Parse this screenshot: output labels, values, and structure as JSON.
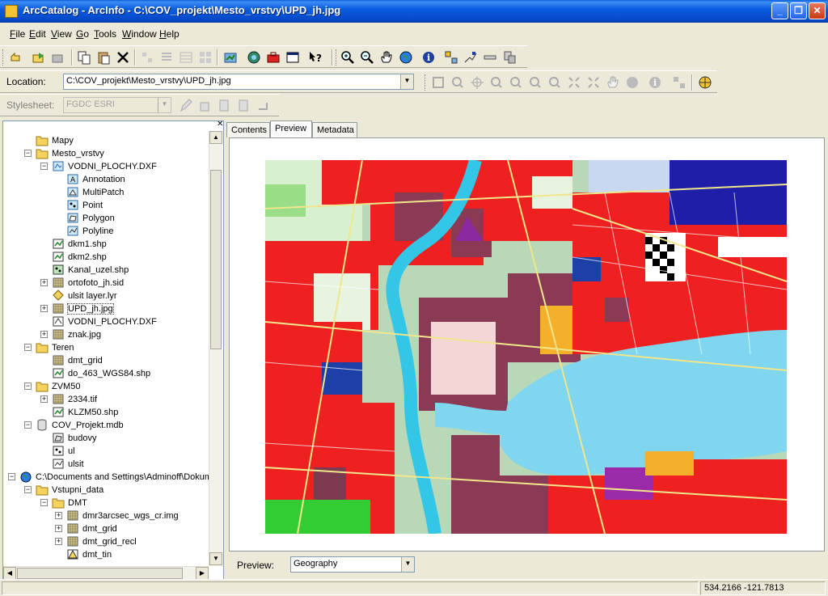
{
  "window": {
    "title": "ArcCatalog - ArcInfo - C:\\COV_projekt\\Mesto_vrstvy\\UPD_jh.jpg",
    "min_glyph": "_",
    "max_glyph": "❐",
    "close_glyph": "✕"
  },
  "menu": [
    {
      "label": "File",
      "key": "F",
      "rest": "ile"
    },
    {
      "label": "Edit",
      "key": "E",
      "rest": "dit"
    },
    {
      "label": "View",
      "key": "V",
      "rest": "iew"
    },
    {
      "label": "Go",
      "key": "G",
      "rest": "o"
    },
    {
      "label": "Tools",
      "key": "T",
      "rest": "ools"
    },
    {
      "label": "Window",
      "key": "W",
      "rest": "indow"
    },
    {
      "label": "Help",
      "key": "H",
      "rest": "elp"
    }
  ],
  "location": {
    "label": "Location:",
    "value": "C:\\COV_projekt\\Mesto_vrstvy\\UPD_jh.jpg"
  },
  "stylesheet": {
    "label": "Stylesheet:",
    "value": "FGDC ESRI"
  },
  "panel": {
    "close_glyph": "✕"
  },
  "tree": [
    {
      "label": "Mapy",
      "icon": "folder-icon"
    },
    {
      "label": "Mesto_vrstvy",
      "icon": "folder-icon"
    },
    {
      "label": "VODNI_PLOCHY.DXF",
      "icon": "cad-icon"
    },
    {
      "label": "Annotation",
      "icon": "annotation-icon"
    },
    {
      "label": "MultiPatch",
      "icon": "multipatch-icon"
    },
    {
      "label": "Point",
      "icon": "point-icon"
    },
    {
      "label": "Polygon",
      "icon": "polygon-icon"
    },
    {
      "label": "Polyline",
      "icon": "polyline-icon"
    },
    {
      "label": "dkm1.shp",
      "icon": "shapefile-icon"
    },
    {
      "label": "dkm2.shp",
      "icon": "shapefile-icon"
    },
    {
      "label": "Kanal_uzel.shp",
      "icon": "shapefile-point-icon"
    },
    {
      "label": "ortofoto_jh.sid",
      "icon": "raster-icon"
    },
    {
      "label": "ulsit layer.lyr",
      "icon": "layer-file-icon"
    },
    {
      "label": "UPD_jh.jpg",
      "icon": "raster-icon"
    },
    {
      "label": "VODNI_PLOCHY.DXF",
      "icon": "cad-drawing-icon"
    },
    {
      "label": "znak.jpg",
      "icon": "raster-icon"
    },
    {
      "label": "Teren",
      "icon": "folder-icon"
    },
    {
      "label": "dmt_grid",
      "icon": "raster-icon"
    },
    {
      "label": "do_463_WGS84.shp",
      "icon": "shapefile-icon"
    },
    {
      "label": "ZVM50",
      "icon": "folder-icon"
    },
    {
      "label": "2334.tif",
      "icon": "raster-icon"
    },
    {
      "label": "KLZM50.shp",
      "icon": "shapefile-icon"
    },
    {
      "label": "COV_Projekt.mdb",
      "icon": "database-icon"
    },
    {
      "label": "budovy",
      "icon": "feature-class-polygon-icon"
    },
    {
      "label": "ul",
      "icon": "feature-class-point-icon"
    },
    {
      "label": "ulsit",
      "icon": "feature-class-line-icon"
    },
    {
      "label": "C:\\Documents and Settings\\Adminoff\\Dokum",
      "icon": "connection-icon"
    },
    {
      "label": "Vstupni_data",
      "icon": "folder-icon"
    },
    {
      "label": "DMT",
      "icon": "folder-icon"
    },
    {
      "label": "dmr3arcsec_wgs_cr.img",
      "icon": "raster-icon"
    },
    {
      "label": "dmt_grid",
      "icon": "raster-icon"
    },
    {
      "label": "dmt_grid_recl",
      "icon": "raster-icon"
    },
    {
      "label": "dmt_tin",
      "icon": "tin-icon"
    }
  ],
  "tabs": [
    {
      "label": "Contents"
    },
    {
      "label": "Preview"
    },
    {
      "label": "Metadata"
    }
  ],
  "preview": {
    "label": "Preview:",
    "value": "Geography"
  },
  "status": {
    "coords": "534.2166  -121.7813"
  }
}
